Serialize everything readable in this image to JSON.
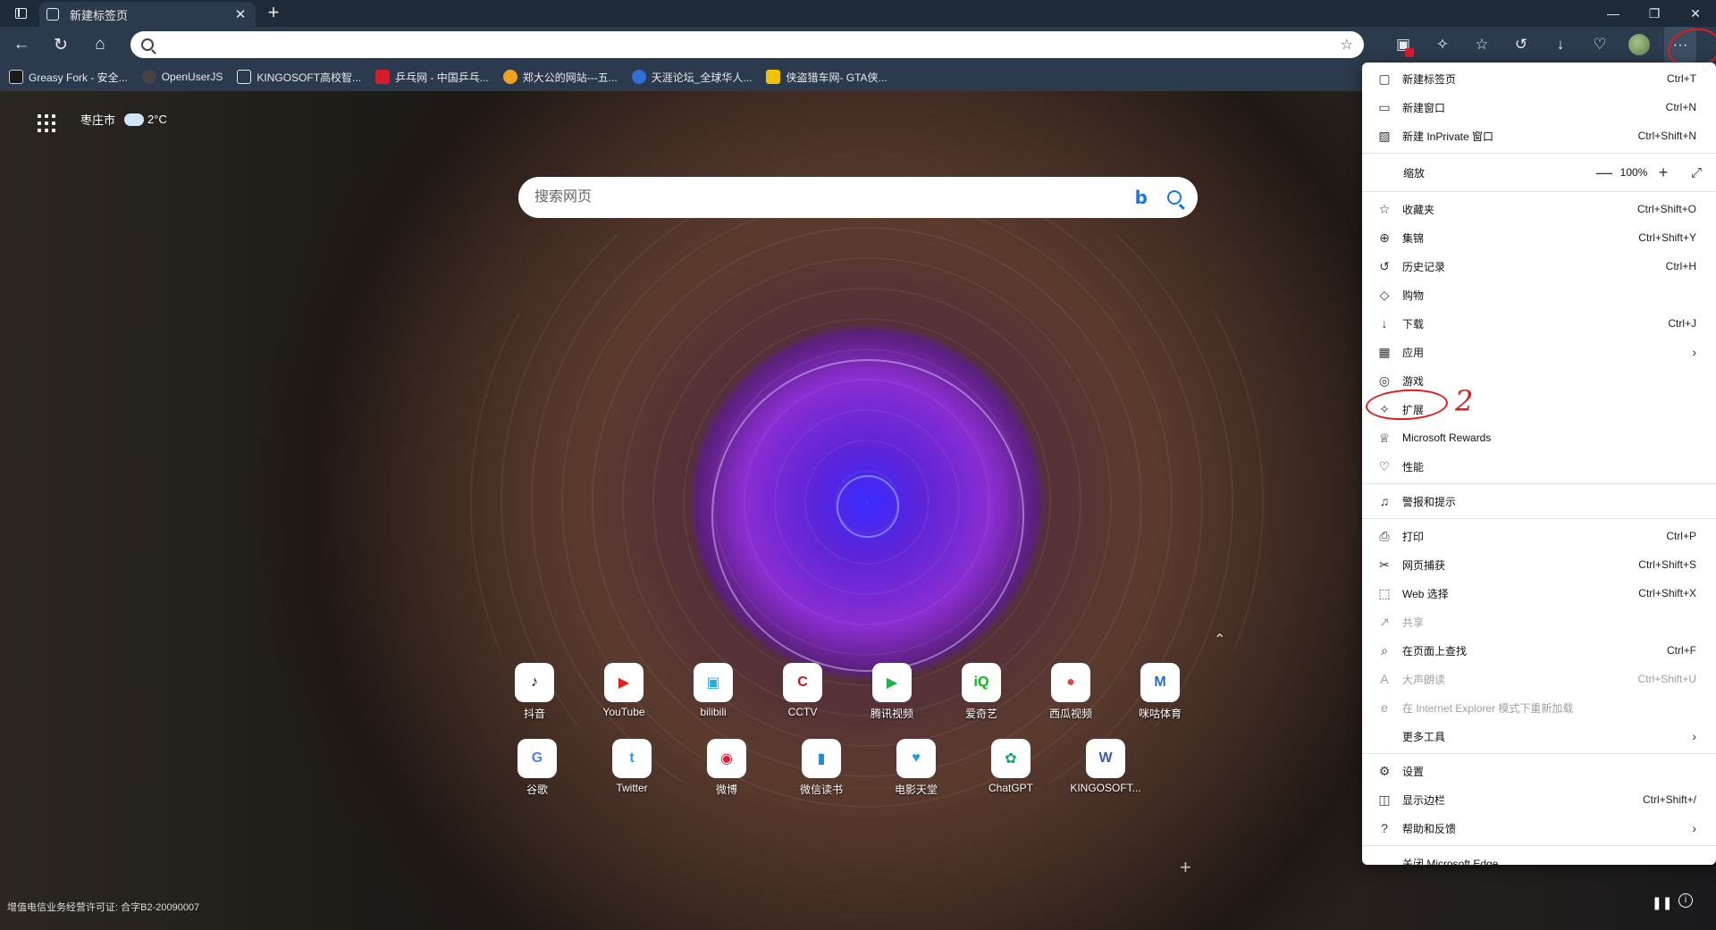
{
  "tab": {
    "title": "新建标签页",
    "close": "✕"
  },
  "window_controls": {
    "minimize": "—",
    "maximize": "❐",
    "close": "✕"
  },
  "address_bar": {
    "value": "",
    "placeholder": ""
  },
  "favorites": [
    {
      "label": "Greasy Fork - 安全...",
      "color": "#1a1a1a"
    },
    {
      "label": "OpenUserJS",
      "color": "#444444"
    },
    {
      "label": "KINGOSOFT高校智...",
      "color": "#3d4b5c"
    },
    {
      "label": "乒乓网 - 中国乒乓...",
      "color": "#d81b2a"
    },
    {
      "label": "郑大公的网站---五...",
      "color": "#f0a21f"
    },
    {
      "label": "天涯论坛_全球华人...",
      "color": "#2f6fd6"
    },
    {
      "label": "侠盗猎车网- GTA侠...",
      "color": "#f2c200"
    }
  ],
  "weather": {
    "city": "枣庄市",
    "temp": "2°C"
  },
  "search": {
    "placeholder": "搜索网页"
  },
  "tiles_row1": [
    {
      "label": "抖音",
      "glyph": "♪",
      "color": "#111111"
    },
    {
      "label": "YouTube",
      "glyph": "▶",
      "color": "#e62117"
    },
    {
      "label": "bilibili",
      "glyph": "▣",
      "color": "#23ade5"
    },
    {
      "label": "CCTV",
      "glyph": "C",
      "color": "#c4151c"
    },
    {
      "label": "腾讯视频",
      "glyph": "▶",
      "color": "#20b14a"
    },
    {
      "label": "爱奇艺",
      "glyph": "iQ",
      "color": "#00be06"
    },
    {
      "label": "西瓜视频",
      "glyph": "●",
      "color": "#f04142"
    },
    {
      "label": "咪咕体育",
      "glyph": "M",
      "color": "#1f6fd6"
    }
  ],
  "tiles_row2": [
    {
      "label": "谷歌",
      "glyph": "G",
      "color": "#4285f4"
    },
    {
      "label": "Twitter",
      "glyph": "t",
      "color": "#1da1f2"
    },
    {
      "label": "微博",
      "glyph": "◉",
      "color": "#e6162d"
    },
    {
      "label": "微信读书",
      "glyph": "▮",
      "color": "#1e88e5"
    },
    {
      "label": "电影天堂",
      "glyph": "♥",
      "color": "#1e9be6"
    },
    {
      "label": "ChatGPT",
      "glyph": "✿",
      "color": "#10a37f"
    },
    {
      "label": "KINGOSOFT...",
      "glyph": "W",
      "color": "#3b5bb5"
    }
  ],
  "license_text": "增值电信业务经营许可证: 合字B2-20090007",
  "menu": {
    "items_group1": [
      {
        "label": "新建标签页",
        "shortcut": "Ctrl+T",
        "icon": "▢"
      },
      {
        "label": "新建窗口",
        "shortcut": "Ctrl+N",
        "icon": "▭"
      },
      {
        "label": "新建 InPrivate 窗口",
        "shortcut": "Ctrl+Shift+N",
        "icon": "▨"
      }
    ],
    "zoom": {
      "label": "缩放",
      "value": "100%",
      "minus": "—",
      "plus": "+",
      "full": "⤢"
    },
    "items_group2": [
      {
        "label": "收藏夹",
        "shortcut": "Ctrl+Shift+O",
        "icon": "☆"
      },
      {
        "label": "集锦",
        "shortcut": "Ctrl+Shift+Y",
        "icon": "⊕"
      },
      {
        "label": "历史记录",
        "shortcut": "Ctrl+H",
        "icon": "↺"
      },
      {
        "label": "购物",
        "shortcut": "",
        "icon": "◇"
      },
      {
        "label": "下载",
        "shortcut": "Ctrl+J",
        "icon": "↓"
      },
      {
        "label": "应用",
        "shortcut": "",
        "icon": "▦",
        "arrow": "›"
      },
      {
        "label": "游戏",
        "shortcut": "",
        "icon": "◎"
      },
      {
        "label": "扩展",
        "shortcut": "",
        "icon": "✧"
      },
      {
        "label": "Microsoft Rewards",
        "shortcut": "",
        "icon": "♕"
      },
      {
        "label": "性能",
        "shortcut": "",
        "icon": "♡"
      }
    ],
    "items_group3": [
      {
        "label": "警报和提示",
        "shortcut": "",
        "icon": "♫"
      }
    ],
    "items_group4": [
      {
        "label": "打印",
        "shortcut": "Ctrl+P",
        "icon": "⎙"
      },
      {
        "label": "网页捕获",
        "shortcut": "Ctrl+Shift+S",
        "icon": "✂"
      },
      {
        "label": "Web 选择",
        "shortcut": "Ctrl+Shift+X",
        "icon": "⬚"
      },
      {
        "label": "共享",
        "shortcut": "",
        "icon": "↗",
        "disabled": true
      },
      {
        "label": "在页面上查找",
        "shortcut": "Ctrl+F",
        "icon": "⌕"
      },
      {
        "label": "大声朗读",
        "shortcut": "Ctrl+Shift+U",
        "icon": "A",
        "disabled": true
      },
      {
        "label": "在 Internet Explorer 模式下重新加载",
        "shortcut": "",
        "icon": "e",
        "disabled": true
      },
      {
        "label": "更多工具",
        "shortcut": "",
        "icon": "",
        "arrow": "›"
      }
    ],
    "items_group5": [
      {
        "label": "设置",
        "shortcut": "",
        "icon": "⚙"
      },
      {
        "label": "显示边栏",
        "shortcut": "Ctrl+Shift+/",
        "icon": "◫"
      },
      {
        "label": "帮助和反馈",
        "shortcut": "",
        "icon": "?",
        "arrow": "›"
      }
    ],
    "items_group6": [
      {
        "label": "关闭 Microsoft Edge",
        "shortcut": "",
        "icon": ""
      }
    ]
  },
  "annotations": {
    "num2": "2"
  }
}
